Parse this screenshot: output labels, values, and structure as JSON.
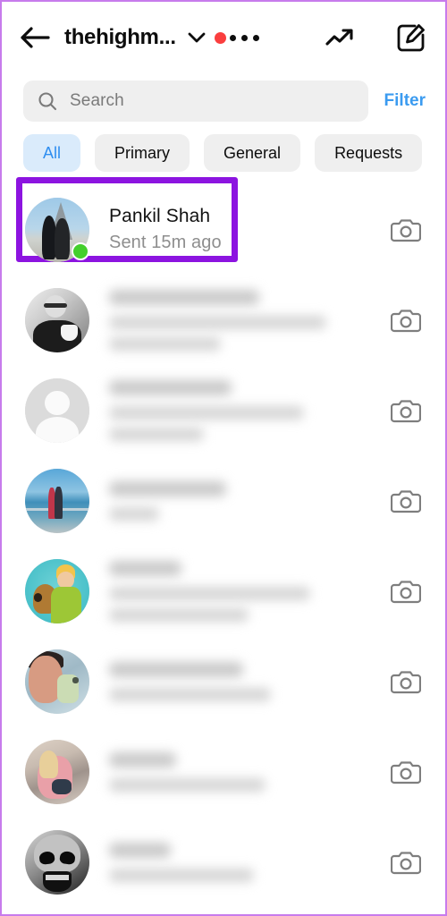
{
  "header": {
    "back_icon": "arrow-left-icon",
    "title": "thehighm...",
    "chevron_icon": "chevron-down-icon",
    "badge_color": "#fa3e3e",
    "more_icon": "ellipsis-icon",
    "trending_icon": "trending-up-icon",
    "compose_icon": "compose-icon"
  },
  "search": {
    "icon": "search-icon",
    "placeholder": "Search",
    "value": "",
    "filter_label": "Filter",
    "filter_color": "#3b9bf0"
  },
  "tabs": [
    {
      "label": "All",
      "active": true
    },
    {
      "label": "Primary",
      "active": false
    },
    {
      "label": "General",
      "active": false
    },
    {
      "label": "Requests",
      "active": false
    }
  ],
  "highlight": {
    "color": "#8c14e0",
    "target": "first-conversation-row"
  },
  "threads": [
    {
      "name": "Pankil Shah",
      "preview": "Sent 15m ago",
      "avatar": "eiffel-tower-couple-photo",
      "online": true,
      "blurred": false,
      "highlighted": true,
      "camera_icon": "camera-icon"
    },
    {
      "name": "",
      "preview": "",
      "avatar": "black-and-white-man-with-cup-photo",
      "online": false,
      "blurred": true,
      "highlighted": false,
      "camera_icon": "camera-icon"
    },
    {
      "name": "",
      "preview": "",
      "avatar": "default-profile-placeholder",
      "online": false,
      "blurred": true,
      "highlighted": false,
      "camera_icon": "camera-icon"
    },
    {
      "name": "",
      "preview": "",
      "avatar": "couple-on-pier-photo",
      "online": false,
      "blurred": true,
      "highlighted": false,
      "camera_icon": "camera-icon"
    },
    {
      "name": "",
      "preview": "",
      "avatar": "scooby-doo-cartoon",
      "online": false,
      "blurred": true,
      "highlighted": false,
      "camera_icon": "camera-icon"
    },
    {
      "name": "",
      "preview": "",
      "avatar": "mirror-selfie-photo",
      "online": false,
      "blurred": true,
      "highlighted": false,
      "camera_icon": "camera-icon"
    },
    {
      "name": "",
      "preview": "",
      "avatar": "beach-portrait-photo",
      "online": false,
      "blurred": true,
      "highlighted": false,
      "camera_icon": "camera-icon"
    },
    {
      "name": "",
      "preview": "",
      "avatar": "skull-artwork",
      "online": false,
      "blurred": true,
      "highlighted": false,
      "camera_icon": "camera-icon"
    }
  ]
}
